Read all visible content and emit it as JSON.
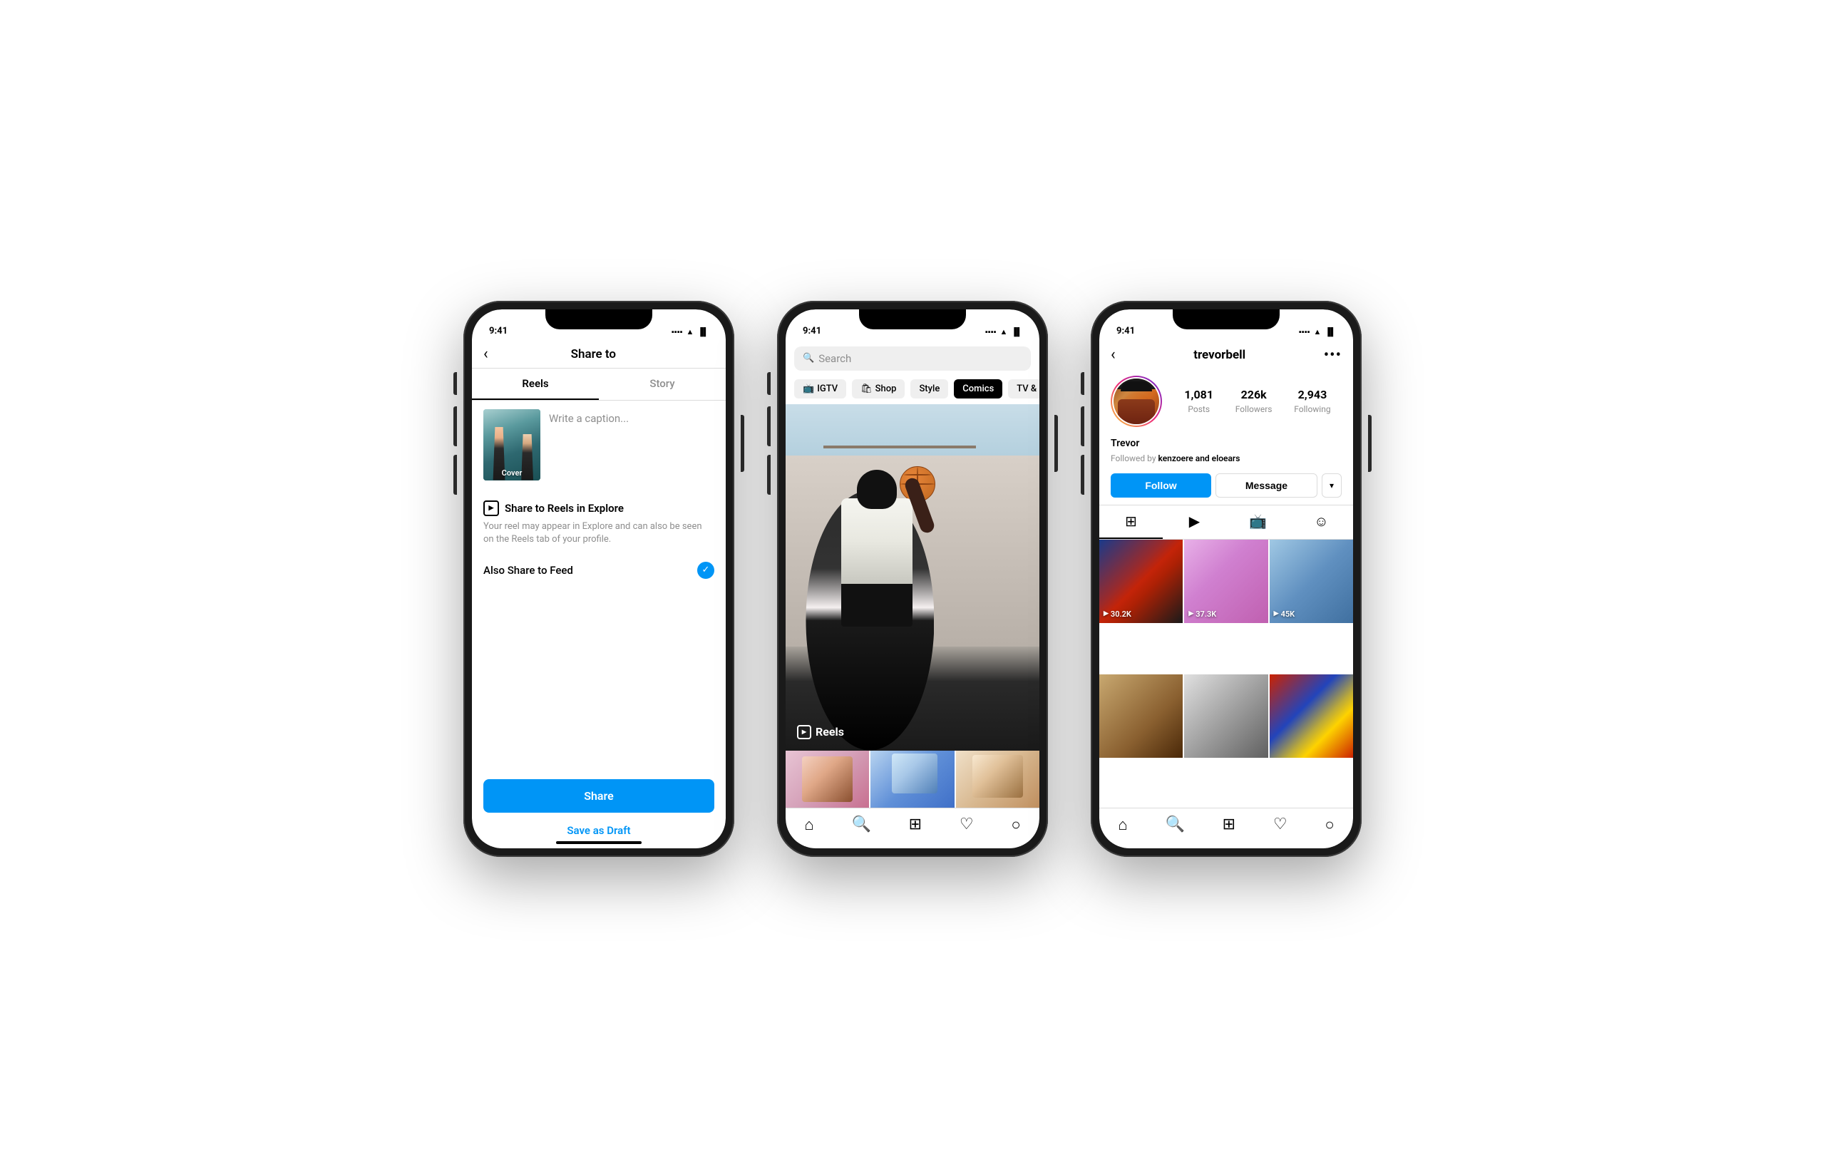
{
  "page": {
    "background": "#ffffff"
  },
  "phone1": {
    "status_time": "9:41",
    "header_title": "Share to",
    "tab_reels": "Reels",
    "tab_story": "Story",
    "cover_label": "Cover",
    "caption_placeholder": "Write a caption...",
    "share_explore_title": "Share to Reels in Explore",
    "share_explore_desc": "Your reel may appear in Explore and can also be seen on the Reels tab of your profile.",
    "also_share_label": "Also Share to Feed",
    "share_btn": "Share",
    "save_draft_btn": "Save as Draft"
  },
  "phone2": {
    "status_time": "9:41",
    "search_placeholder": "Search",
    "filter_chips": [
      {
        "label": "IGTV",
        "icon": "📺",
        "selected": false
      },
      {
        "label": "Shop",
        "icon": "🛍",
        "selected": false
      },
      {
        "label": "Style",
        "icon": "",
        "selected": false
      },
      {
        "label": "Comics",
        "icon": "",
        "selected": true
      },
      {
        "label": "TV & Movies",
        "icon": "",
        "selected": false
      }
    ],
    "reels_label": "Reels"
  },
  "phone3": {
    "status_time": "9:41",
    "username": "trevorbell",
    "display_name": "Trevor",
    "followed_by_text": "Followed by ",
    "followed_by_names": "kenzoere and eloears",
    "stats": {
      "posts_count": "1,081",
      "posts_label": "Posts",
      "followers_count": "226k",
      "followers_label": "Followers",
      "following_count": "2,943",
      "following_label": "Following"
    },
    "follow_btn": "Follow",
    "message_btn": "Message",
    "grid_counts": [
      "30.2K",
      "37.3K",
      "45K"
    ]
  }
}
